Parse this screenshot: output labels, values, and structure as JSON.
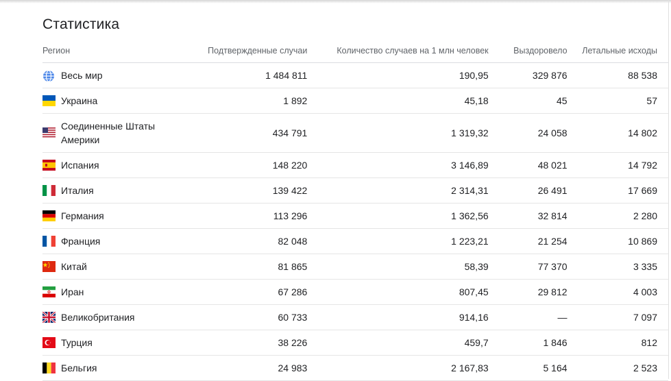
{
  "title": "Статистика",
  "columns": {
    "region": "Регион",
    "confirmed": "Подтвержденные случаи",
    "per_million": "Количество случаев на 1 млн человек",
    "recovered": "Выздоровело",
    "deaths": "Летальные исходы"
  },
  "rows": [
    {
      "icon": "globe-icon",
      "region": "Весь мир",
      "confirmed": "1 484 811",
      "per_million": "190,95",
      "recovered": "329 876",
      "deaths": "88 538"
    },
    {
      "icon": "ukraine-flag-icon",
      "region": "Украина",
      "confirmed": "1 892",
      "per_million": "45,18",
      "recovered": "45",
      "deaths": "57"
    },
    {
      "icon": "usa-flag-icon",
      "region": "Соединенные Штаты Америки",
      "confirmed": "434 791",
      "per_million": "1 319,32",
      "recovered": "24 058",
      "deaths": "14 802"
    },
    {
      "icon": "spain-flag-icon",
      "region": "Испания",
      "confirmed": "148 220",
      "per_million": "3 146,89",
      "recovered": "48 021",
      "deaths": "14 792"
    },
    {
      "icon": "italy-flag-icon",
      "region": "Италия",
      "confirmed": "139 422",
      "per_million": "2 314,31",
      "recovered": "26 491",
      "deaths": "17 669"
    },
    {
      "icon": "germany-flag-icon",
      "region": "Германия",
      "confirmed": "113 296",
      "per_million": "1 362,56",
      "recovered": "32 814",
      "deaths": "2 280"
    },
    {
      "icon": "france-flag-icon",
      "region": "Франция",
      "confirmed": "82 048",
      "per_million": "1 223,21",
      "recovered": "21 254",
      "deaths": "10 869"
    },
    {
      "icon": "china-flag-icon",
      "region": "Китай",
      "confirmed": "81 865",
      "per_million": "58,39",
      "recovered": "77 370",
      "deaths": "3 335"
    },
    {
      "icon": "iran-flag-icon",
      "region": "Иран",
      "confirmed": "67 286",
      "per_million": "807,45",
      "recovered": "29 812",
      "deaths": "4 003"
    },
    {
      "icon": "uk-flag-icon",
      "region": "Великобритания",
      "confirmed": "60 733",
      "per_million": "914,16",
      "recovered": "—",
      "deaths": "7 097"
    },
    {
      "icon": "turkey-flag-icon",
      "region": "Турция",
      "confirmed": "38 226",
      "per_million": "459,7",
      "recovered": "1 846",
      "deaths": "812"
    },
    {
      "icon": "belgium-flag-icon",
      "region": "Бельгия",
      "confirmed": "24 983",
      "per_million": "2 167,83",
      "recovered": "5 164",
      "deaths": "2 523"
    }
  ]
}
